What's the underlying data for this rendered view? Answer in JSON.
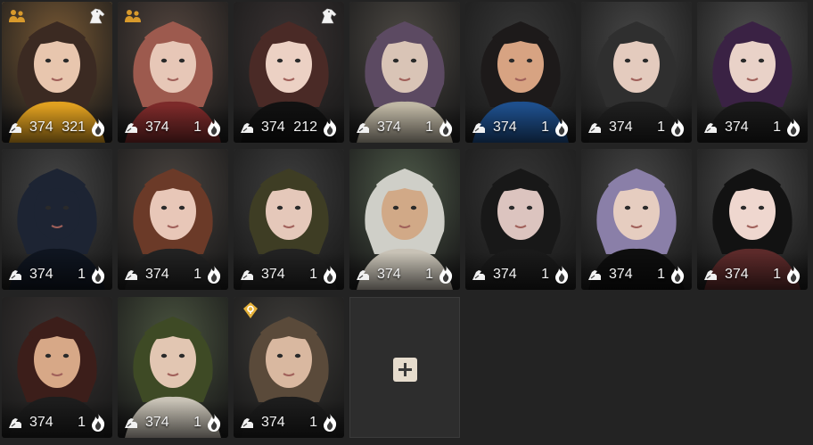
{
  "characters": [
    {
      "gear_score": "374",
      "count": "321",
      "selected": true,
      "icons": [
        "party-icon",
        "horse-icon"
      ],
      "bg": "#7a5a35",
      "hair": "#3b2a22",
      "skin": "#e8c6ae",
      "accent": "#e0a020"
    },
    {
      "gear_score": "374",
      "count": "1",
      "selected": false,
      "icons": [
        "party-icon"
      ],
      "bg": "#55463f",
      "hair": "#9d5a4e",
      "skin": "#e7c7b7",
      "accent": "#7c2a2a"
    },
    {
      "gear_score": "374",
      "count": "212",
      "selected": false,
      "icons": [
        "horse-icon"
      ],
      "bg": "#3a3333",
      "hair": "#4a2a26",
      "skin": "#ecd1c4",
      "accent": "#111111"
    },
    {
      "gear_score": "374",
      "count": "1",
      "selected": false,
      "icons": [],
      "bg": "#4e4a45",
      "hair": "#5c4a62",
      "skin": "#d9c4b6",
      "accent": "#bfb7a4"
    },
    {
      "gear_score": "374",
      "count": "1",
      "selected": false,
      "icons": [],
      "bg": "#383838",
      "hair": "#1d1a1a",
      "skin": "#d7a382",
      "accent": "#1e4f8c"
    },
    {
      "gear_score": "374",
      "count": "1",
      "selected": false,
      "icons": [],
      "bg": "#484848",
      "hair": "#2f2f2f",
      "skin": "#e4cbbe",
      "accent": "#1f1f1f"
    },
    {
      "gear_score": "374",
      "count": "1",
      "selected": false,
      "icons": [],
      "bg": "#515151",
      "hair": "#3a2244",
      "skin": "#e9d2c8",
      "accent": "#1a1a1a"
    },
    {
      "gear_score": "374",
      "count": "1",
      "selected": false,
      "icons": [],
      "bg": "#474747",
      "hair": "#1d2433",
      "skin": "#1d2433",
      "accent": "#0f1520"
    },
    {
      "gear_score": "374",
      "count": "1",
      "selected": false,
      "icons": [],
      "bg": "#4a4440",
      "hair": "#6b3a28",
      "skin": "#e8c7b8",
      "accent": "#222222"
    },
    {
      "gear_score": "374",
      "count": "1",
      "selected": false,
      "icons": [],
      "bg": "#3e3e3e",
      "hair": "#3e3d24",
      "skin": "#e5c8ba",
      "accent": "#222222"
    },
    {
      "gear_score": "374",
      "count": "1",
      "selected": false,
      "icons": [],
      "bg": "#4f5b4a",
      "hair": "#cfcfc8",
      "skin": "#d1a987",
      "accent": "#c8c2b6"
    },
    {
      "gear_score": "374",
      "count": "1",
      "selected": false,
      "icons": [],
      "bg": "#363636",
      "hair": "#181818",
      "skin": "#dcc4bf",
      "accent": "#1a1a1a"
    },
    {
      "gear_score": "374",
      "count": "1",
      "selected": false,
      "icons": [],
      "bg": "#474747",
      "hair": "#8a7fa8",
      "skin": "#e6cdc0",
      "accent": "#0e0e0e"
    },
    {
      "gear_score": "374",
      "count": "1",
      "selected": false,
      "icons": [],
      "bg": "#4a4a4a",
      "hair": "#121212",
      "skin": "#efd7cf",
      "accent": "#5c2a2a"
    },
    {
      "gear_score": "374",
      "count": "1",
      "selected": false,
      "icons": [],
      "bg": "#3b3635",
      "hair": "#3c1e1a",
      "skin": "#d7a887",
      "accent": "#1d1d1d"
    },
    {
      "gear_score": "374",
      "count": "1",
      "selected": false,
      "icons": [],
      "bg": "#4b5540",
      "hair": "#3e4a25",
      "skin": "#e2c6b2",
      "accent": "#c8c2b6"
    },
    {
      "gear_score": "374",
      "count": "1",
      "selected": false,
      "icons": [
        "gold-badge-icon"
      ],
      "bg": "#3f3d3a",
      "hair": "#5a4a3a",
      "skin": "#d9b8a0",
      "accent": "#1d1d1d"
    }
  ],
  "add_slot": {
    "label": "+"
  },
  "colors": {
    "selected_border": "#c9a25a",
    "party_icon": "#d89a2c",
    "gold_badge": "#e6b23a"
  }
}
